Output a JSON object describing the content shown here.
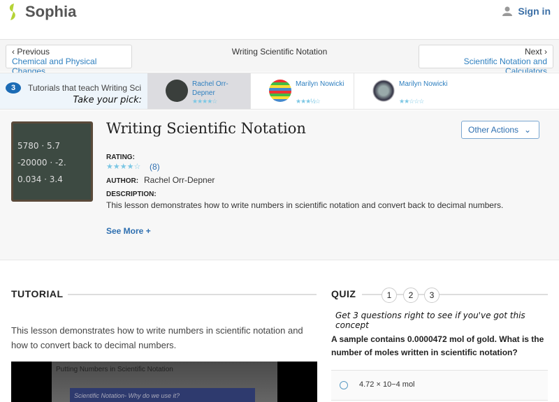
{
  "header": {
    "brand": "Sophia",
    "sign_in": "Sign in"
  },
  "nav": {
    "prev_label": "Previous",
    "prev_link": "Chemical and Physical Changes",
    "title": "Writing Scientific Notation",
    "next_label": "Next",
    "next_link": "Scientific Notation and Calculators"
  },
  "tutorials": {
    "count": "3",
    "label": "Tutorials that teach Writing Scientific Notation",
    "pick": "Take your pick:",
    "items": [
      {
        "author": "Rachel Orr-Depner",
        "stars": "★★★★☆",
        "rating": 4
      },
      {
        "author": "Marilyn Nowicki",
        "stars": "★★★½☆",
        "rating": 3.5
      },
      {
        "author": "Marilyn Nowicki",
        "stars": "★★☆☆☆",
        "rating": 2
      }
    ]
  },
  "lesson": {
    "title": "Writing Scientific Notation",
    "thumb_lines": [
      "5780 · 5.7",
      "-20000 · -2.",
      "0.034 · 3.4"
    ],
    "rating_label": "Rating:",
    "stars": "★★★★☆",
    "rating_count": "(8)",
    "author_label": "Author:",
    "author": "Rachel Orr-Depner",
    "description_label": "Description:",
    "description": "This lesson demonstrates how to write numbers in scientific notation and convert back to decimal numbers.",
    "see_more": "See More +",
    "other_actions": "Other Actions"
  },
  "tutorial": {
    "heading": "TUTORIAL",
    "text": "This lesson demonstrates how to write numbers in scientific notation and how to convert back to decimal numbers.",
    "video_title": "Putting Numbers in Scientific Notation",
    "video_slide": "Scientific Notation- Why do we use it?"
  },
  "quiz": {
    "heading": "QUIZ",
    "steps": [
      "1",
      "2",
      "3"
    ],
    "subtitle": "Get 3 questions right to see if you've got this concept",
    "question": "A sample contains 0.0000472 mol of gold. What is the number of moles written in scientific notation?",
    "option1": "4.72 × 10−4 mol"
  }
}
